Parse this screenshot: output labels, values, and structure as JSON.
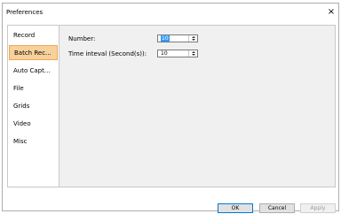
{
  "window": {
    "title": "Preferences",
    "close_glyph": "×"
  },
  "sidebar": {
    "items": [
      {
        "label": "Record",
        "selected": false
      },
      {
        "label": "Batch Rec...",
        "selected": true
      },
      {
        "label": "Auto Capt...",
        "selected": false
      },
      {
        "label": "File",
        "selected": false
      },
      {
        "label": "Grids",
        "selected": false
      },
      {
        "label": "Video",
        "selected": false
      },
      {
        "label": "Misc",
        "selected": false
      }
    ]
  },
  "form": {
    "number": {
      "label": "Number:",
      "value": "10"
    },
    "interval": {
      "label": "Time inteval (Second(s)):",
      "value": "10"
    }
  },
  "buttons": {
    "ok": "OK",
    "cancel": "Cancel",
    "apply": "Apply"
  },
  "colors": {
    "selected_bg": "#f7d19b",
    "selected_border": "#f0a85a",
    "focus": "#3399ff"
  }
}
